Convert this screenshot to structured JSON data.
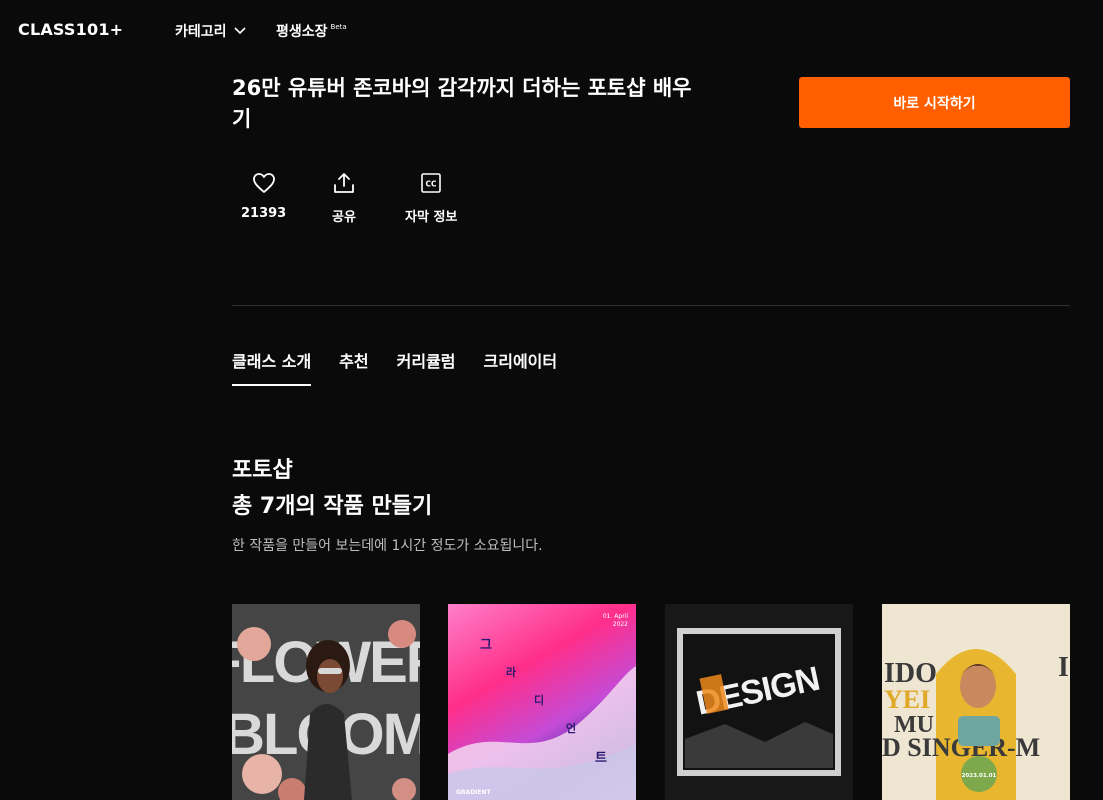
{
  "header": {
    "logo": "CLASS101+",
    "category_label": "카테고리",
    "library_label": "평생소장",
    "beta_label": "Beta"
  },
  "course": {
    "title": "26만 유튜버 존코바의 감각까지 더하는 포토샵 배우기",
    "cta_label": "바로 시작하기"
  },
  "actions": {
    "likes": "21393",
    "share": "공유",
    "subtitle": "자막 정보"
  },
  "tabs": [
    "클래스 소개",
    "추천",
    "커리큘럼",
    "크리에이터"
  ],
  "section": {
    "title_line1": "포토샵",
    "title_line2": "총 7개의 작품 만들기",
    "description": "한 작품을 만들어 보는데에 1시간 정도가 소요됩니다."
  },
  "cards": {
    "c1": {
      "word1": "FLOWER",
      "word2": "BLOOM"
    },
    "c2": {
      "chars": [
        "그",
        "라",
        "디",
        "언",
        "트"
      ],
      "date": "01. April",
      "year": "2022",
      "footer": "GRADIENT"
    },
    "c3": {
      "word": "DESIGN"
    },
    "c4": {
      "line1": "IDO",
      "line2": "YEI",
      "line3": "MU",
      "line4": "D SINGER-M",
      "right": "I",
      "badge": "2023.01.01"
    }
  },
  "colors": {
    "accent": "#ff5f00",
    "background": "#0a0a0a"
  }
}
